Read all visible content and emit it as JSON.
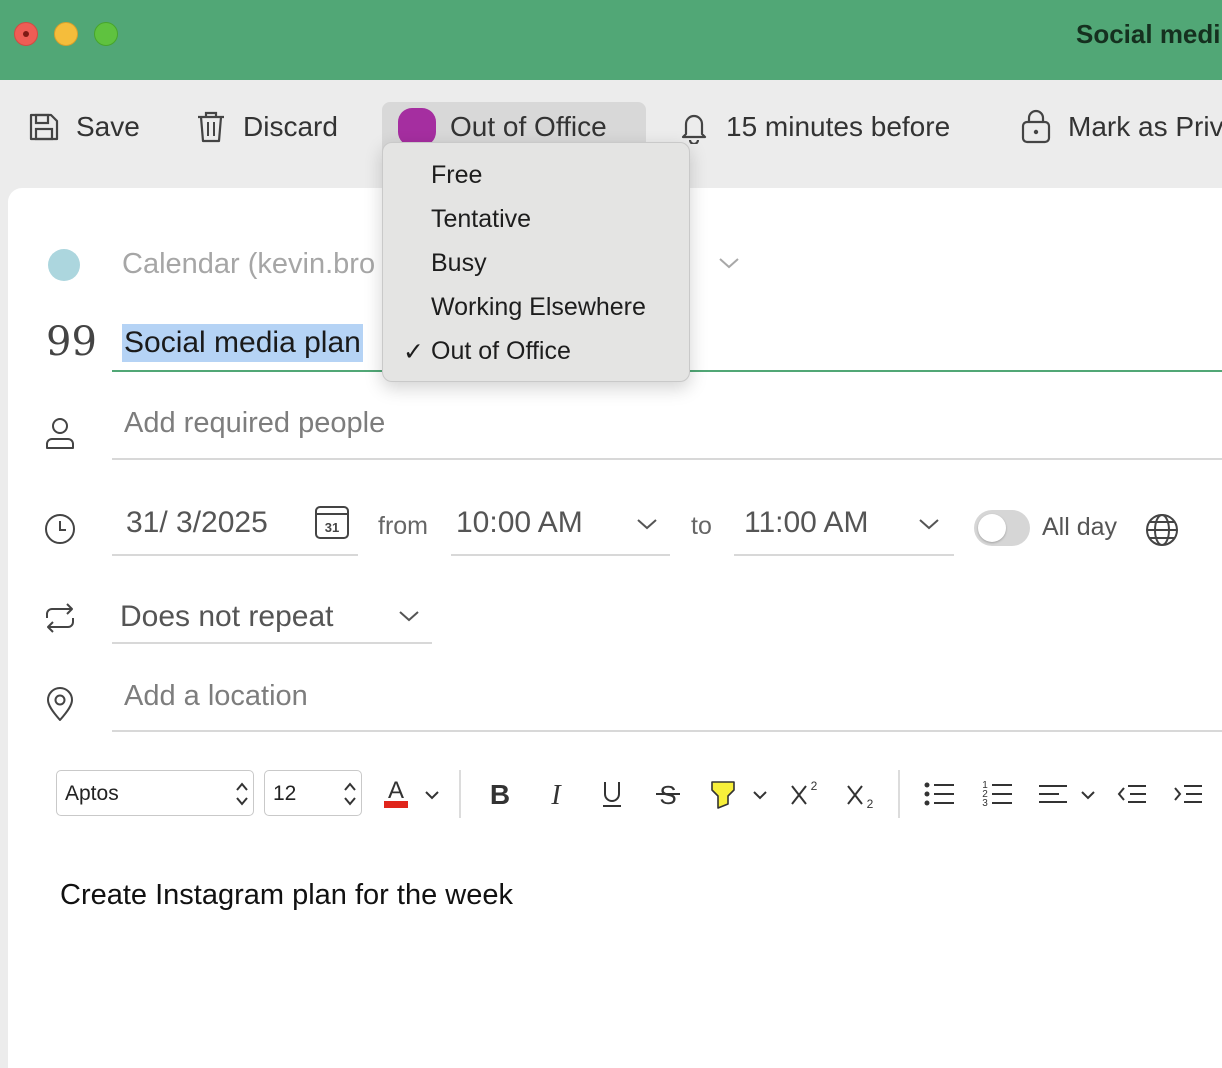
{
  "window": {
    "title": "Social medi"
  },
  "toolbar": {
    "save_label": "Save",
    "discard_label": "Discard",
    "status_label": "Out of Office",
    "reminder_label": "15 minutes before",
    "private_label": "Mark as Priv"
  },
  "status_menu": {
    "items": [
      "Free",
      "Tentative",
      "Busy",
      "Working Elsewhere",
      "Out of Office"
    ],
    "checked_mark": "✓"
  },
  "event": {
    "calendar": "Calendar (kevin.bro",
    "title": "Social media plan",
    "people_placeholder": "Add required people",
    "date": "31/ 3/2025",
    "calendar_day": "31",
    "from_label": "from",
    "start_time": "10:00 AM",
    "to_label": "to",
    "end_time": "11:00 AM",
    "all_day_label": "All day",
    "repeat": "Does not repeat",
    "location_placeholder": "Add a location",
    "body": "Create Instagram plan for the week"
  },
  "format_toolbar": {
    "font": "Aptos",
    "size": "12"
  },
  "colors": {
    "titlebar": "#51a776",
    "status_out_of_office": "#a52ea0",
    "calendar_color": "#acd6de",
    "font_color": "#e0251b",
    "highlight_color": "#f7ef3a"
  }
}
